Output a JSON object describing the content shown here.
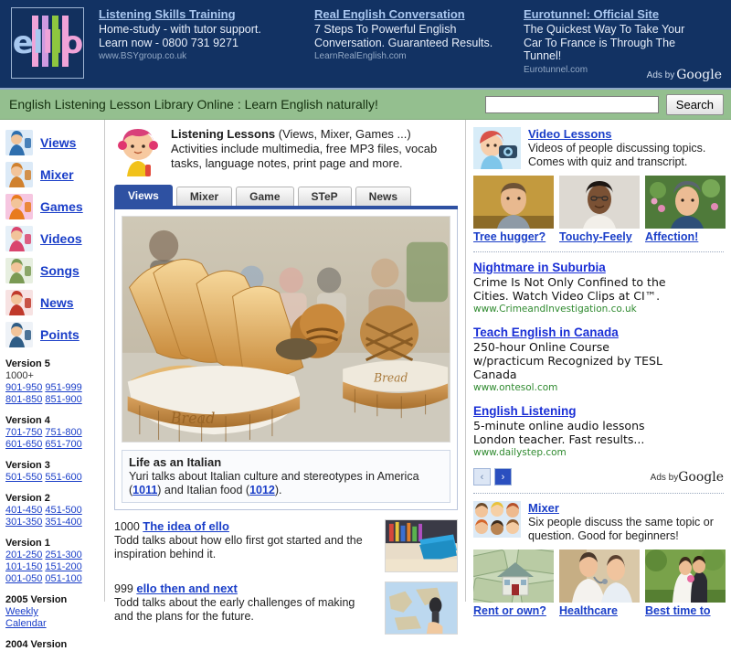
{
  "logo": {
    "text_parts": [
      "e",
      "l",
      "l",
      "l",
      "o"
    ],
    "colors": [
      "#a8c8ef",
      "#a8c8ef",
      "#f0a3d8",
      "#8ec63f",
      "#f0a3d8"
    ],
    "bar_colors": [
      "#f0a3d8",
      "#cf9ae0",
      "#8ec63f",
      "#f0a3d8"
    ]
  },
  "top_ads": {
    "ads_by_label": "Ads by",
    "ads_by_brand": "Google",
    "items": [
      {
        "title": "Listening Skills Training",
        "lines": [
          "Home-study - with tutor support.",
          "Learn now - 0800 731 9271"
        ],
        "url": "www.BSYgroup.co.uk"
      },
      {
        "title": "Real English Conversation",
        "lines": [
          "7 Steps To Powerful English",
          "Conversation. Guaranteed Results."
        ],
        "url": "LearnRealEnglish.com"
      },
      {
        "title": "Eurotunnel: Official Site",
        "lines": [
          "The Quickest Way To Take Your",
          "Car To France is Through The",
          "Tunnel!"
        ],
        "url": "Eurotunnel.com"
      }
    ]
  },
  "header": {
    "title": "English Listening Lesson Library Online : Learn English naturally!",
    "search_value": "",
    "search_placeholder": "",
    "search_button": "Search"
  },
  "sidebar": {
    "nav": [
      {
        "label": "Views",
        "icon": "person-microphone-icon"
      },
      {
        "label": "Mixer",
        "icon": "group-faces-icon"
      },
      {
        "label": "Games",
        "icon": "puzzle-icon"
      },
      {
        "label": "Videos",
        "icon": "camera-person-icon"
      },
      {
        "label": "Songs",
        "icon": "singer-icon"
      },
      {
        "label": "News",
        "icon": "newsreader-icon"
      },
      {
        "label": "Points",
        "icon": "presenter-chart-icon"
      }
    ],
    "versions": [
      {
        "head": "Version 5",
        "sub": "1000+",
        "rows": [
          [
            "901-950",
            "951-999"
          ],
          [
            "801-850",
            "851-900"
          ]
        ]
      },
      {
        "head": "Version 4",
        "sub": "",
        "rows": [
          [
            "701-750",
            "751-800"
          ],
          [
            "601-650",
            "651-700"
          ]
        ]
      },
      {
        "head": "Version 3",
        "sub": "",
        "rows": [
          [
            "501-550",
            "551-600"
          ]
        ]
      },
      {
        "head": "Version 2",
        "sub": "",
        "rows": [
          [
            "401-450",
            "451-500"
          ],
          [
            "301-350",
            "351-400"
          ]
        ]
      },
      {
        "head": "Version 1",
        "sub": "",
        "rows": [
          [
            "201-250",
            "251-300"
          ],
          [
            "101-150",
            "151-200"
          ],
          [
            "001-050",
            "051-100"
          ]
        ]
      },
      {
        "head": "2005 Version",
        "sub": "",
        "rows": [
          [
            "Weekly"
          ],
          [
            "Calendar"
          ]
        ]
      },
      {
        "head": "2004 Version",
        "sub": "",
        "rows": []
      }
    ]
  },
  "main": {
    "lessons_title": "Listening Lessons",
    "lessons_title_suffix": " (Views, Mixer, Games ...)",
    "lessons_desc": "Activities include multimedia, free MP3 files, vocab tasks, language notes, print page and more.",
    "tabs": [
      {
        "label": "Views",
        "active": true
      },
      {
        "label": "Mixer",
        "active": false
      },
      {
        "label": "Game",
        "active": false
      },
      {
        "label": "STeP",
        "active": false
      },
      {
        "label": "News",
        "active": false
      }
    ],
    "hero": {
      "image_alt": "bread-baskets-photo",
      "title": "Life as an Italian",
      "desc_a": "Yuri talks about Italian culture and stereotypes in America (",
      "link_1": "1011",
      "desc_b": ") and Italian food (",
      "link_2": "1012",
      "desc_c": ")."
    },
    "lessons": [
      {
        "number": "1000",
        "title": "The idea of ello",
        "desc": "Todd talks about how ello first got started and the inspiration behind it.",
        "thumb": "stationery-photo"
      },
      {
        "number": "999",
        "title": "ello then and next",
        "desc": "Todd talks about the early challenges of making and the plans for the future.",
        "thumb": "microphone-globe-photo"
      }
    ]
  },
  "right": {
    "video_lessons": {
      "title": "Video Lessons",
      "desc": "Videos of people discussing topics. Comes with quiz and transcript.",
      "thumbs": [
        {
          "caption": "Tree hugger?",
          "alt": "man-yellow-wall-photo"
        },
        {
          "caption": "Touchy-Feely",
          "alt": "woman-glasses-photo"
        },
        {
          "caption": "Affection!",
          "alt": "young-man-garden-photo"
        }
      ]
    },
    "google_ads": {
      "items": [
        {
          "title": "Nightmare in Suburbia",
          "lines": [
            "Crime Is Not Only Confined to the",
            "Cities. Watch Video Clips at CI™."
          ],
          "url": "www.CrimeandInvestigation.co.uk"
        },
        {
          "title": "Teach English in Canada",
          "lines": [
            "250-hour Online Course",
            "w/practicum Recognized by TESL",
            "Canada"
          ],
          "url": "www.ontesol.com"
        },
        {
          "title": "English Listening",
          "lines": [
            "5-minute online audio lessons",
            "London teacher. Fast results..."
          ],
          "url": "www.dailystep.com"
        }
      ],
      "prev_label": "‹",
      "next_label": "›",
      "ads_by_label": "Ads by",
      "ads_by_brand": "Google"
    },
    "mixer": {
      "title": "Mixer",
      "desc": "Six people discuss the same topic or question. Good for beginners!",
      "thumbs": [
        {
          "caption": "Rent or own?",
          "alt": "house-on-money-photo"
        },
        {
          "caption": "Healthcare",
          "alt": "doctor-patient-photo"
        },
        {
          "caption": "Best time to",
          "alt": "wedding-couple-photo"
        }
      ]
    }
  }
}
